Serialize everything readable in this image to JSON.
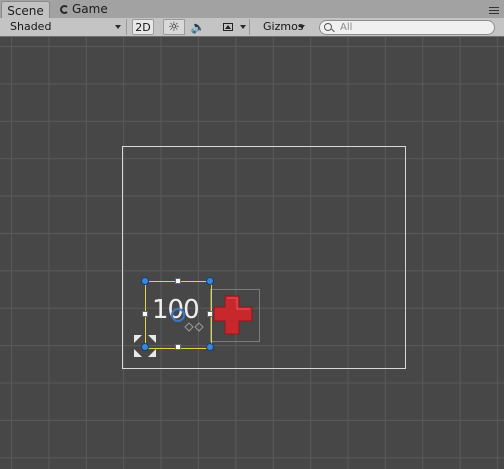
{
  "tabs": {
    "scene": "Scene",
    "game": "Game"
  },
  "toolbar": {
    "shading_mode": "Shaded",
    "mode_2d": "2D",
    "light_icon": "☼",
    "audio_icon": "🔈",
    "gizmos": "Gizmos",
    "search_placeholder": "All"
  },
  "scene": {
    "counter_text": "100"
  },
  "icons": {
    "panel_menu": "tab-menu-icon",
    "light": "light-toggle-icon",
    "audio": "audio-toggle-icon",
    "effects": "image-effects-icon",
    "search": "search-icon",
    "health_cross": "health-cross-icon",
    "pivot": "pivot-handle-icon",
    "anchor": "anchor-icon"
  },
  "colors": {
    "scene_background": "#474747",
    "grid_line": "#5a5a5a",
    "canvas_border": "#d8d8d8",
    "selection_border": "#e0d34a",
    "handle_blue": "#3a86d9",
    "cross_red": "#c8272c"
  }
}
